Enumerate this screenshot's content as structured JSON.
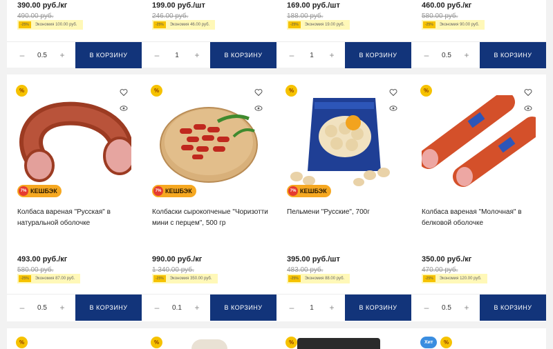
{
  "labels": {
    "add_to_cart": "В КОРЗИНУ",
    "cashback": "КЕШБЭК",
    "cashback_pct": "7%",
    "promo": "%",
    "hit": "Хит",
    "saving_pct": "-25%"
  },
  "top_row": [
    {
      "price": "390.00 руб./кг",
      "old_price": "490.00 руб.",
      "saving": "Экономия 100.00 руб.",
      "qty": "0.5"
    },
    {
      "price": "199.00 руб./шт",
      "old_price": "246.00 руб.",
      "saving": "Экономия 46.00 руб.",
      "qty": "1"
    },
    {
      "price": "169.00 руб./шт",
      "old_price": "188.00 руб.",
      "saving": "Экономия 19.00 руб.",
      "qty": "1"
    },
    {
      "price": "460.00 руб./кг",
      "old_price": "580.00 руб.",
      "saving": "Экономия 90.00 руб.",
      "qty": "0.5"
    }
  ],
  "products": [
    {
      "title": "Колбаса вареная \"Русская\" в натуральной оболочке",
      "price": "493.00 руб./кг",
      "old_price": "580.00 руб.",
      "saving": "Экономия 87.00 руб.",
      "qty": "0.5",
      "cashback": true,
      "image": "boiled-sausage-ring"
    },
    {
      "title": "Колбаски сырокопченые \"Чоризотти мини с перцем\", 500 гр",
      "price": "990.00 руб./кг",
      "old_price": "1 340.00 руб.",
      "saving": "Экономия 350.00 руб.",
      "qty": "0.1",
      "cashback": true,
      "image": "chorizo-board"
    },
    {
      "title": "Пельмени \"Русские\", 700г",
      "price": "395.00 руб./шт",
      "old_price": "483.00 руб.",
      "saving": "Экономия 88.00 руб.",
      "qty": "1",
      "cashback": true,
      "image": "dumplings-pack"
    },
    {
      "title": "Колбаса вареная \"Молочная\" в белковой оболочке",
      "price": "350.00 руб./кг",
      "old_price": "470.00 руб.",
      "saving": "Экономия 120.00 руб.",
      "qty": "0.5",
      "cashback": false,
      "image": "boiled-sausage-sticks"
    }
  ],
  "colors": {
    "cart_button": "#12347a",
    "promo": "#f6c200",
    "cashback": "#f6a821",
    "hit": "#3a8de0"
  }
}
